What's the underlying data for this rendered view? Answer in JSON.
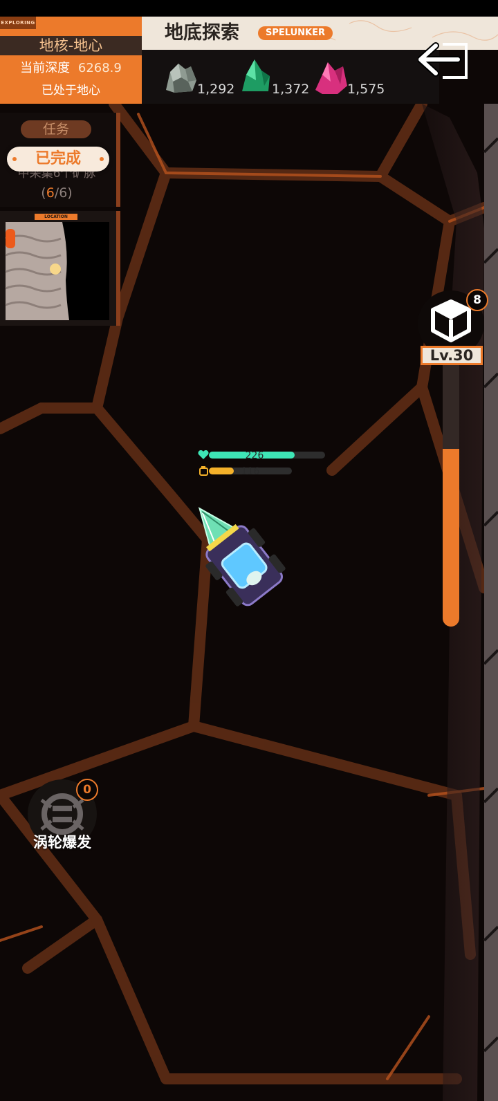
{
  "header": {
    "exploring_tag": "EXPLORING",
    "zone_name": "地核-地心",
    "depth_label": "当前深度",
    "depth_value": "6268.9",
    "status": "已处于地心"
  },
  "title": {
    "text": "地底探索",
    "badge": "SPELUNKER"
  },
  "resources": [
    {
      "icon": "gray-ore-icon",
      "count": "1,292",
      "color": "#8f9b92"
    },
    {
      "icon": "green-crystal-icon",
      "count": "1,372",
      "color": "#2fbf7a"
    },
    {
      "icon": "pink-crystal-icon",
      "count": "1,575",
      "color": "#e0428f"
    }
  ],
  "quest": {
    "title": "任务",
    "description": "中采集6个矿脉",
    "progress_current": "6",
    "progress_total": "6",
    "completed_label": "已完成"
  },
  "minimap": {
    "label": "LOCATION"
  },
  "drill": {
    "level_label": "Lv.30",
    "badge_count": "8",
    "level_progress": 0.68
  },
  "player": {
    "hp": "226",
    "fuel": "116",
    "hp_fraction": 0.74,
    "fuel_fraction": 0.3
  },
  "skill": {
    "name": "涡轮爆发",
    "badge_count": "0"
  },
  "colors": {
    "accent": "#ec7a2b",
    "hp": "#3ee6b6",
    "fuel": "#f4b12a",
    "background": "#0d0706"
  }
}
